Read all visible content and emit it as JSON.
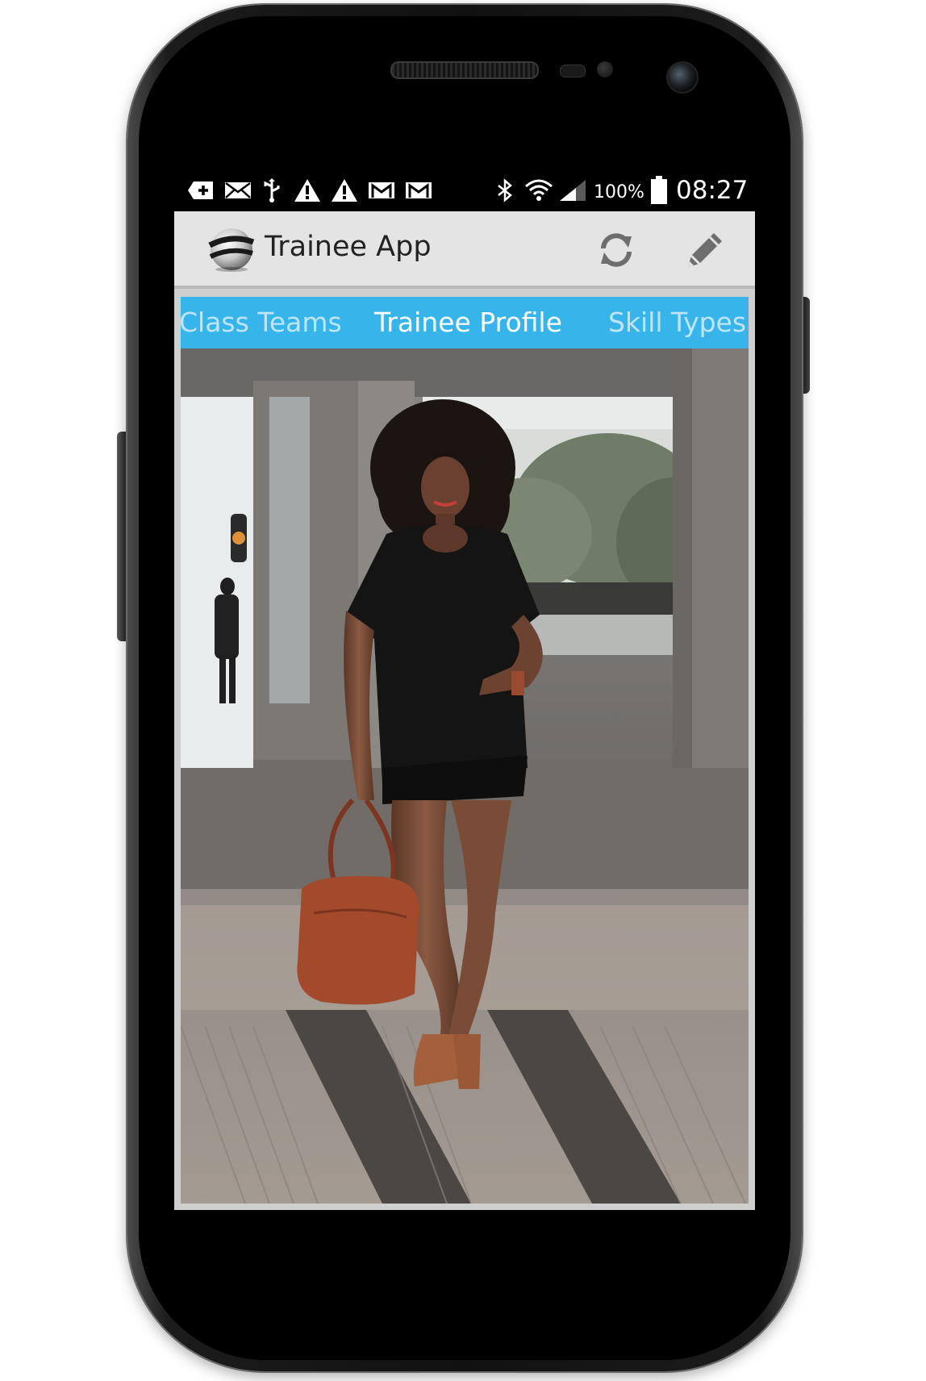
{
  "status_bar": {
    "left_icons": [
      "add-notification-icon",
      "email-icon",
      "usb-icon",
      "warning-icon",
      "warning-icon",
      "gmail-icon",
      "gmail-icon"
    ],
    "right_icons": [
      "bluetooth-icon",
      "wifi-icon",
      "signal-icon",
      "battery-icon"
    ],
    "battery_percent": "100%",
    "time": "08:27"
  },
  "action_bar": {
    "app_title": "Trainee App",
    "logo_icon": "app-globe-logo-icon",
    "actions": [
      {
        "name": "refresh",
        "icon": "refresh-icon"
      },
      {
        "name": "edit",
        "icon": "pencil-icon"
      }
    ]
  },
  "tabs": [
    {
      "label": "Class Teams",
      "selected": false
    },
    {
      "label": "Trainee Profile",
      "selected": true
    },
    {
      "label": "Skill Types",
      "selected": false
    }
  ],
  "content": {
    "image_type": "trainee-profile-photo"
  },
  "colors": {
    "tab_strip": "#37b5ea",
    "action_bar": "#e4e4e4",
    "status_bar": "#000000"
  }
}
